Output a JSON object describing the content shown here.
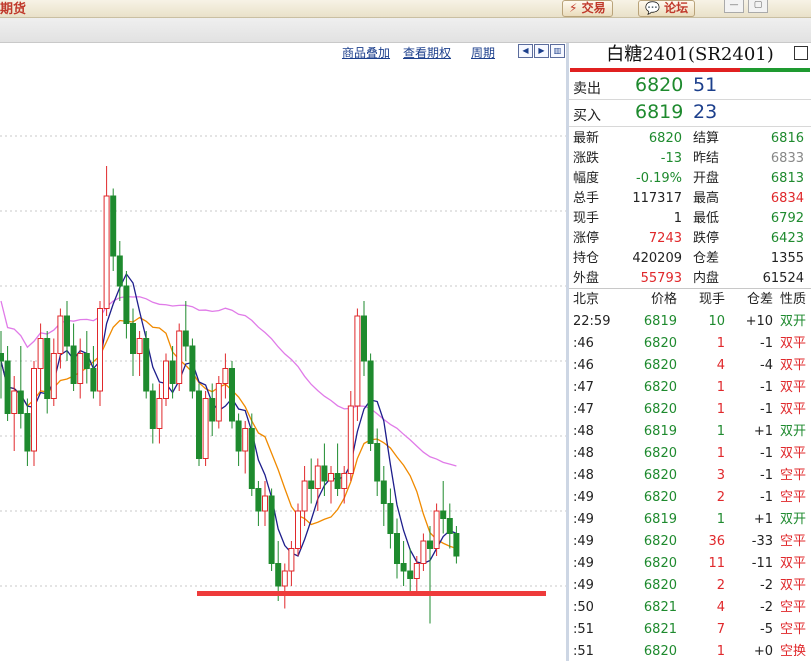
{
  "app": {
    "title": "期货",
    "trade_button": "交易",
    "forum_button": "论坛"
  },
  "colors": {
    "up": "#e0282b",
    "down": "#1e8a2e",
    "label": "#1c3f8c",
    "ma_short": "#1e1e8c",
    "ma_mid": "#f08a00",
    "ma_long": "#e07be8",
    "support_line": "#ee3b3b"
  },
  "toolbar": {
    "overlay_link": "商品叠加",
    "options_link": "查看期权",
    "period_link": "周期"
  },
  "panel": {
    "title": "白糖2401(SR2401)",
    "sell": {
      "label": "卖出",
      "price": "6820",
      "volume": "51"
    },
    "buy": {
      "label": "买入",
      "price": "6819",
      "volume": "23"
    },
    "stats": [
      {
        "l1": "最新",
        "v1": "6820",
        "l2": "结算",
        "v2": "6816"
      },
      {
        "l1": "涨跌",
        "v1": "-13",
        "l2": "昨结",
        "v2": "6833"
      },
      {
        "l1": "幅度",
        "v1": "-0.19%",
        "l2": "开盘",
        "v2": "6813"
      },
      {
        "l1": "总手",
        "v1": "117317",
        "l2": "最高",
        "v2": "6834"
      },
      {
        "l1": "现手",
        "v1": "1",
        "l2": "最低",
        "v2": "6792"
      },
      {
        "l1": "涨停",
        "v1": "7243",
        "l2": "跌停",
        "v2": "6423"
      },
      {
        "l1": "持仓",
        "v1": "420209",
        "l2": "仓差",
        "v2": "1355"
      },
      {
        "l1": "外盘",
        "v1": "55793",
        "l2": "内盘",
        "v2": "61524"
      }
    ],
    "tick_header": {
      "time": "北京",
      "price": "价格",
      "volume": "现手",
      "oi_change": "仓差",
      "nature": "性质"
    },
    "ticks": [
      {
        "time": "22:59",
        "price": "6819",
        "volume": "10",
        "oi": "+10",
        "nature": "双开"
      },
      {
        "time": ":46",
        "price": "6820",
        "volume": "1",
        "oi": "-1",
        "nature": "双平"
      },
      {
        "time": ":46",
        "price": "6820",
        "volume": "4",
        "oi": "-4",
        "nature": "双平"
      },
      {
        "time": ":47",
        "price": "6820",
        "volume": "1",
        "oi": "-1",
        "nature": "双平"
      },
      {
        "time": ":47",
        "price": "6820",
        "volume": "1",
        "oi": "-1",
        "nature": "双平"
      },
      {
        "time": ":48",
        "price": "6819",
        "volume": "1",
        "oi": "+1",
        "nature": "双开"
      },
      {
        "time": ":48",
        "price": "6820",
        "volume": "1",
        "oi": "-1",
        "nature": "双平"
      },
      {
        "time": ":48",
        "price": "6820",
        "volume": "3",
        "oi": "-1",
        "nature": "空平"
      },
      {
        "time": ":49",
        "price": "6820",
        "volume": "2",
        "oi": "-1",
        "nature": "空平"
      },
      {
        "time": ":49",
        "price": "6819",
        "volume": "1",
        "oi": "+1",
        "nature": "双开"
      },
      {
        "time": ":49",
        "price": "6820",
        "volume": "36",
        "oi": "-33",
        "nature": "空平"
      },
      {
        "time": ":49",
        "price": "6820",
        "volume": "11",
        "oi": "-11",
        "nature": "双平"
      },
      {
        "time": ":49",
        "price": "6820",
        "volume": "2",
        "oi": "-2",
        "nature": "双平"
      },
      {
        "time": ":50",
        "price": "6821",
        "volume": "4",
        "oi": "-2",
        "nature": "空平"
      },
      {
        "time": ":51",
        "price": "6821",
        "volume": "7",
        "oi": "-5",
        "nature": "空平"
      },
      {
        "time": ":51",
        "price": "6820",
        "volume": "1",
        "oi": "+0",
        "nature": "空换"
      }
    ]
  },
  "chart_data": {
    "type": "candlestick",
    "ylim": [
      6750,
      7150
    ],
    "support_level": 6795,
    "candles": [
      [
        6955,
        6970,
        6925,
        6950
      ],
      [
        6950,
        6960,
        6910,
        6915
      ],
      [
        6915,
        6940,
        6890,
        6930
      ],
      [
        6930,
        6960,
        6905,
        6915
      ],
      [
        6915,
        6925,
        6880,
        6890
      ],
      [
        6890,
        6950,
        6880,
        6945
      ],
      [
        6945,
        6975,
        6930,
        6965
      ],
      [
        6965,
        6970,
        6915,
        6925
      ],
      [
        6925,
        6965,
        6920,
        6955
      ],
      [
        6955,
        6985,
        6945,
        6980
      ],
      [
        6980,
        6990,
        6950,
        6960
      ],
      [
        6960,
        6975,
        6930,
        6935
      ],
      [
        6935,
        6965,
        6925,
        6955
      ],
      [
        6955,
        6970,
        6935,
        6945
      ],
      [
        6945,
        6960,
        6925,
        6930
      ],
      [
        6930,
        6990,
        6920,
        6985
      ],
      [
        6985,
        7080,
        6980,
        7060
      ],
      [
        7060,
        7065,
        7010,
        7020
      ],
      [
        7020,
        7030,
        6990,
        7000
      ],
      [
        7000,
        7010,
        6965,
        6975
      ],
      [
        6975,
        6985,
        6940,
        6955
      ],
      [
        6955,
        6970,
        6940,
        6965
      ],
      [
        6965,
        6970,
        6925,
        6930
      ],
      [
        6930,
        6935,
        6895,
        6905
      ],
      [
        6905,
        6935,
        6895,
        6925
      ],
      [
        6925,
        6955,
        6920,
        6950
      ],
      [
        6950,
        6960,
        6925,
        6935
      ],
      [
        6935,
        6975,
        6930,
        6970
      ],
      [
        6970,
        6990,
        6950,
        6960
      ],
      [
        6960,
        6965,
        6925,
        6930
      ],
      [
        6930,
        6935,
        6880,
        6885
      ],
      [
        6885,
        6930,
        6880,
        6925
      ],
      [
        6925,
        6935,
        6900,
        6910
      ],
      [
        6910,
        6940,
        6905,
        6935
      ],
      [
        6935,
        6955,
        6925,
        6945
      ],
      [
        6945,
        6950,
        6905,
        6910
      ],
      [
        6910,
        6915,
        6880,
        6890
      ],
      [
        6890,
        6910,
        6875,
        6905
      ],
      [
        6905,
        6915,
        6860,
        6865
      ],
      [
        6865,
        6870,
        6840,
        6850
      ],
      [
        6850,
        6870,
        6840,
        6860
      ],
      [
        6860,
        6865,
        6810,
        6815
      ],
      [
        6815,
        6830,
        6790,
        6800
      ],
      [
        6800,
        6815,
        6785,
        6810
      ],
      [
        6810,
        6830,
        6800,
        6825
      ],
      [
        6825,
        6855,
        6820,
        6850
      ],
      [
        6850,
        6880,
        6840,
        6870
      ],
      [
        6870,
        6885,
        6855,
        6865
      ],
      [
        6865,
        6885,
        6850,
        6880
      ],
      [
        6880,
        6895,
        6860,
        6870
      ],
      [
        6870,
        6880,
        6855,
        6875
      ],
      [
        6875,
        6895,
        6860,
        6865
      ],
      [
        6865,
        6880,
        6855,
        6875
      ],
      [
        6875,
        6930,
        6870,
        6920
      ],
      [
        6920,
        6985,
        6910,
        6980
      ],
      [
        6980,
        6990,
        6940,
        6950
      ],
      [
        6950,
        6955,
        6890,
        6895
      ],
      [
        6895,
        6905,
        6860,
        6870
      ],
      [
        6870,
        6880,
        6840,
        6855
      ],
      [
        6855,
        6865,
        6825,
        6835
      ],
      [
        6835,
        6845,
        6805,
        6815
      ],
      [
        6815,
        6830,
        6800,
        6810
      ],
      [
        6810,
        6825,
        6795,
        6805
      ],
      [
        6805,
        6820,
        6795,
        6815
      ],
      [
        6815,
        6835,
        6810,
        6830
      ],
      [
        6830,
        6840,
        6775,
        6825
      ],
      [
        6825,
        6855,
        6820,
        6850
      ],
      [
        6850,
        6870,
        6835,
        6845
      ],
      [
        6845,
        6855,
        6825,
        6835
      ],
      [
        6835,
        6840,
        6815,
        6820
      ]
    ]
  }
}
